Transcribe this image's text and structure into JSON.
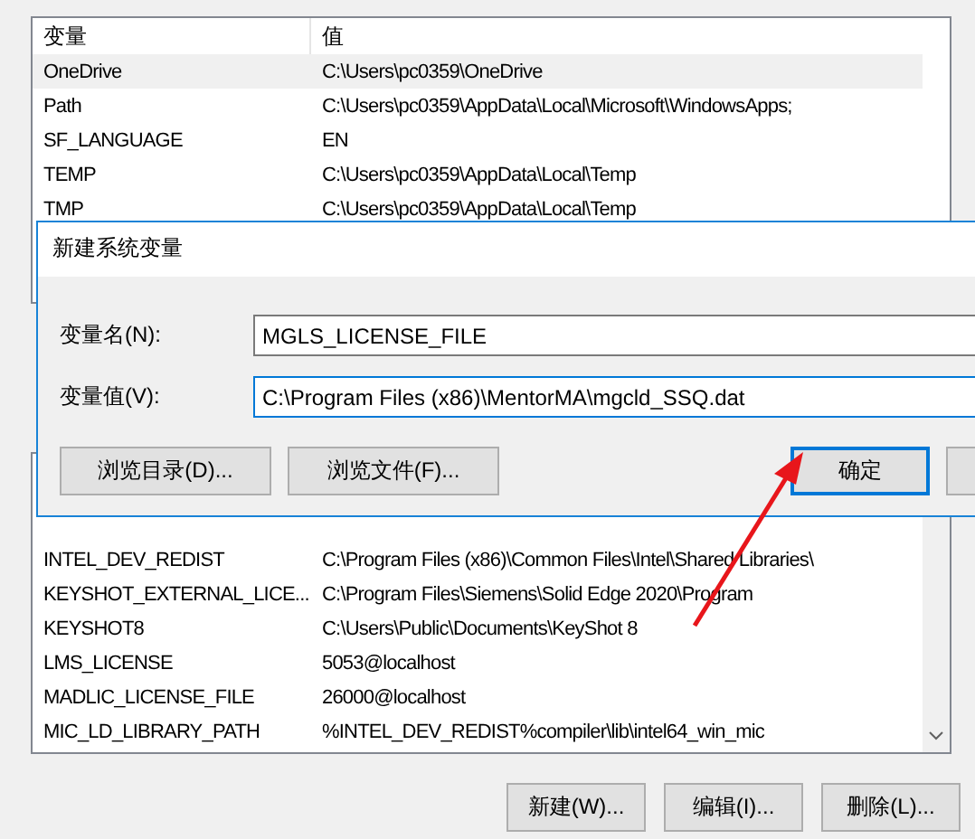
{
  "background_window": {
    "user_variables": {
      "columns": [
        "变量",
        "值"
      ],
      "rows": [
        {
          "name": "OneDrive",
          "value": "C:\\Users\\pc0359\\OneDrive",
          "selected": true
        },
        {
          "name": "Path",
          "value": "C:\\Users\\pc0359\\AppData\\Local\\Microsoft\\WindowsApps;",
          "selected": false
        },
        {
          "name": "SF_LANGUAGE",
          "value": "EN",
          "selected": false
        },
        {
          "name": "TEMP",
          "value": "C:\\Users\\pc0359\\AppData\\Local\\Temp",
          "selected": false
        },
        {
          "name": "TMP",
          "value": "C:\\Users\\pc0359\\AppData\\Local\\Temp",
          "selected": false
        }
      ]
    },
    "system_variables": {
      "rows": [
        {
          "name": "INTEL_DEV_REDIST",
          "value": "C:\\Program Files (x86)\\Common Files\\Intel\\Shared Libraries\\",
          "selected": false
        },
        {
          "name": "KEYSHOT_EXTERNAL_LICE...",
          "value": "C:\\Program Files\\Siemens\\Solid Edge 2020\\Program",
          "selected": false
        },
        {
          "name": "KEYSHOT8",
          "value": "C:\\Users\\Public\\Documents\\KeyShot 8",
          "selected": false
        },
        {
          "name": "LMS_LICENSE",
          "value": "5053@localhost",
          "selected": false
        },
        {
          "name": "MADLIC_LICENSE_FILE",
          "value": "26000@localhost",
          "selected": false
        },
        {
          "name": "MIC_LD_LIBRARY_PATH",
          "value": "%INTEL_DEV_REDIST%compiler\\lib\\intel64_win_mic",
          "selected": false
        }
      ]
    },
    "buttons": [
      "新建(W)...",
      "编辑(I)...",
      "删除(L)..."
    ]
  },
  "dialog": {
    "title": "新建系统变量",
    "fields": [
      {
        "label": "变量名(N):",
        "value": "MGLS_LICENSE_FILE",
        "focused": false
      },
      {
        "label": "变量值(V):",
        "value": "C:\\Program Files (x86)\\MentorMA\\mgcld_SSQ.dat",
        "focused": true
      }
    ],
    "buttons": [
      {
        "label": "浏览目录(D)...",
        "default": false
      },
      {
        "label": "浏览文件(F)...",
        "default": false
      },
      {
        "label": "确定",
        "default": true
      },
      {
        "default": false
      }
    ]
  }
}
